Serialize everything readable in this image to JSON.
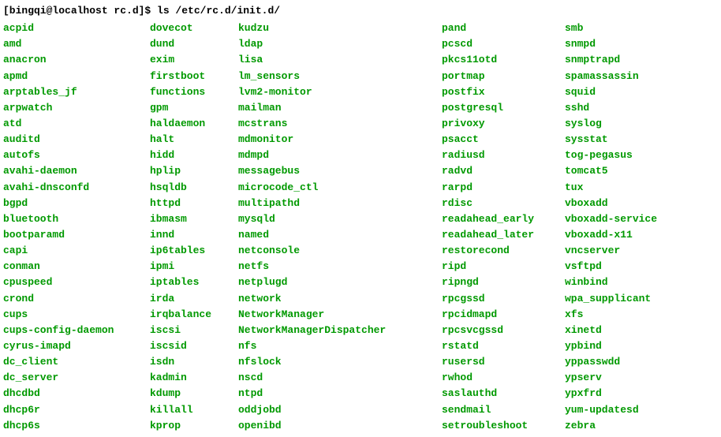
{
  "prompt": "[bingqi@localhost rc.d]$ ls /etc/rc.d/init.d/",
  "columns": {
    "c1": [
      "acpid",
      "amd",
      "anacron",
      "apmd",
      "arptables_jf",
      "arpwatch",
      "atd",
      "auditd",
      "autofs",
      "avahi-daemon",
      "avahi-dnsconfd",
      "bgpd",
      "bluetooth",
      "bootparamd",
      "capi",
      "conman",
      "cpuspeed",
      "crond",
      "cups",
      "cups-config-daemon",
      "cyrus-imapd",
      "dc_client",
      "dc_server",
      "dhcdbd",
      "dhcp6r",
      "dhcp6s"
    ],
    "c2": [
      "dovecot",
      "dund",
      "exim",
      "firstboot",
      "functions",
      "gpm",
      "haldaemon",
      "halt",
      "hidd",
      "hplip",
      "hsqldb",
      "httpd",
      "ibmasm",
      "innd",
      "ip6tables",
      "ipmi",
      "iptables",
      "irda",
      "irqbalance",
      "iscsi",
      "iscsid",
      "isdn",
      "kadmin",
      "kdump",
      "killall",
      "kprop"
    ],
    "c3": [
      "kudzu",
      "ldap",
      "lisa",
      "lm_sensors",
      "lvm2-monitor",
      "mailman",
      "mcstrans",
      "mdmonitor",
      "mdmpd",
      "messagebus",
      "microcode_ctl",
      "multipathd",
      "mysqld",
      "named",
      "netconsole",
      "netfs",
      "netplugd",
      "network",
      "NetworkManager",
      "NetworkManagerDispatcher",
      "nfs",
      "nfslock",
      "nscd",
      "ntpd",
      "oddjobd",
      "openibd"
    ],
    "c4": [
      "pand",
      "pcscd",
      "pkcs11otd",
      "portmap",
      "postfix",
      "postgresql",
      "privoxy",
      "psacct",
      "radiusd",
      "radvd",
      "rarpd",
      "rdisc",
      "readahead_early",
      "readahead_later",
      "restorecond",
      "ripd",
      "ripngd",
      "rpcgssd",
      "rpcidmapd",
      "rpcsvcgssd",
      "rstatd",
      "rusersd",
      "rwhod",
      "saslauthd",
      "sendmail",
      "setroubleshoot"
    ],
    "c5": [
      "smb",
      "snmpd",
      "snmptrapd",
      "spamassassin",
      "squid",
      "sshd",
      "syslog",
      "sysstat",
      "tog-pegasus",
      "tomcat5",
      "tux",
      "vboxadd",
      "vboxadd-service",
      "vboxadd-x11",
      "vncserver",
      "vsftpd",
      "winbind",
      "wpa_supplicant",
      "xfs",
      "xinetd",
      "ypbind",
      "yppasswdd",
      "ypserv",
      "ypxfrd",
      "yum-updatesd",
      "zebra"
    ]
  }
}
